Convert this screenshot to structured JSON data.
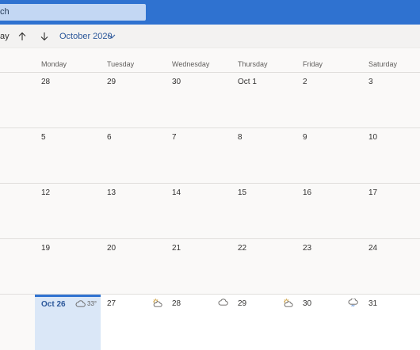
{
  "search": {
    "placeholder_visible": "ch"
  },
  "toolbar": {
    "today_label": "ay",
    "month_label": "October 2020"
  },
  "weekdays": [
    "Monday",
    "Tuesday",
    "Wednesday",
    "Thursday",
    "Friday",
    "Saturday"
  ],
  "weeks": [
    [
      "28",
      "29",
      "30",
      "Oct 1",
      "2",
      "3"
    ],
    [
      "5",
      "6",
      "7",
      "8",
      "9",
      "10"
    ],
    [
      "12",
      "13",
      "14",
      "15",
      "16",
      "17"
    ],
    [
      "19",
      "20",
      "21",
      "22",
      "23",
      "24"
    ],
    [
      "Oct 26",
      "27",
      "28",
      "29",
      "30",
      "31"
    ]
  ],
  "today": {
    "label": "Oct 26",
    "temp": "33°",
    "weather_icon": "cloudy-icon"
  },
  "forecast_icons": [
    "partly-sunny-icon",
    "cloudy-icon",
    "partly-sunny-icon",
    "rain-icon"
  ],
  "colors": {
    "accent": "#2f72d0",
    "today_bg": "#dae7f7",
    "search_bg": "#c3d7f3"
  }
}
